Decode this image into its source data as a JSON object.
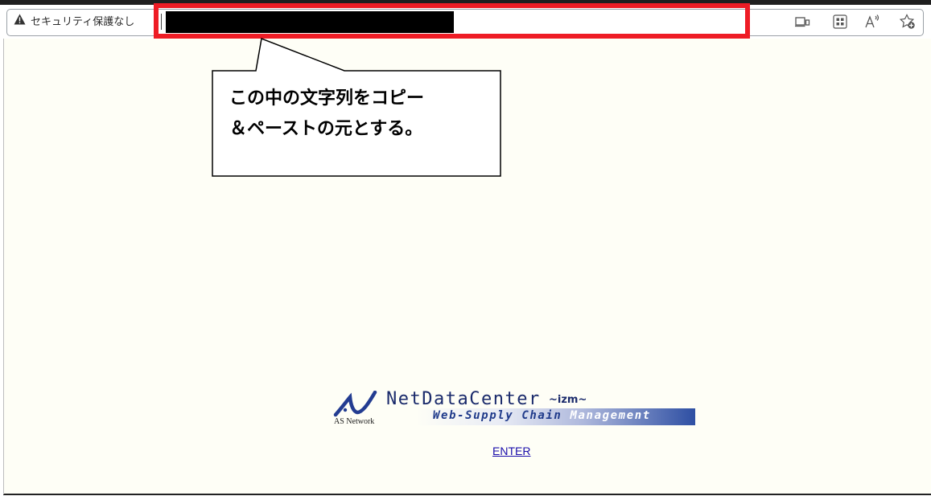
{
  "browser": {
    "security_label": "セキュリティ保護なし",
    "url_state": "redacted",
    "toolbar_icons": [
      "device-view-icon",
      "app-icon",
      "read-aloud-icon",
      "favorites-add-icon"
    ]
  },
  "annotation": {
    "callout_text": "この中の文字列をコピー\n＆ペーストの元とする。",
    "highlight_color": "#ee1c25"
  },
  "page": {
    "background": "#fefef6",
    "logo": {
      "name": "NetDataCenter",
      "suffix": "~izm~",
      "tagline_part1": "Web-Supply Chain ",
      "tagline_part2": "Management",
      "company": "AS Network",
      "brand_color": "#1a2a6b"
    },
    "enter_link": "ENTER",
    "link_color": "#1a0dab"
  }
}
